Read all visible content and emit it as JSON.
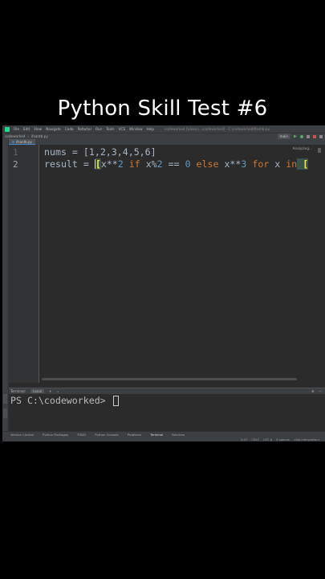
{
  "video_title": "Python Skill Test #6",
  "ide": {
    "menu": [
      "File",
      "Edit",
      "View",
      "Navigate",
      "Code",
      "Refactor",
      "Run",
      "Tools",
      "VCS",
      "Window",
      "Help"
    ],
    "project_path": "codeworked [\\Users\\...\\codeworked] - C:\\codeworked\\flashb.py",
    "breadcrumb_project": "codeworked",
    "breadcrumb_file": "ifsantb.py",
    "run_config": "main",
    "tab_label": "ifsantb.py",
    "analyzing": "Analyzing...",
    "line_numbers": [
      "1",
      "2"
    ],
    "code": {
      "line1": {
        "var": "nums",
        "eq": " = ",
        "list": "[1,2,3,4,5,6]"
      },
      "line2": {
        "var": "result",
        "eq": " = ",
        "open": "[",
        "x1": "x**",
        "n2": "2",
        "if": "if",
        "mod": " x%",
        "n2b": "2",
        "eqeq": " == ",
        "n0": "0",
        "else": "else",
        "x3": " x**",
        "n3": "3",
        "for": "for",
        "x_var": " x ",
        "in": "in",
        "tail": " ["
      }
    },
    "terminal": {
      "title": "Terminal:",
      "tab": "Local",
      "plus": "+",
      "dropdown": "⌄",
      "prompt": "PS C:\\codeworked>"
    },
    "bottom_tools": [
      "Version Control",
      "Python Packages",
      "TODO",
      "Python Console",
      "Problems",
      "Terminal",
      "Services"
    ],
    "status": [
      "2:47",
      "CRLF",
      "UTF-8",
      "4 spaces",
      "<No interpreter>"
    ]
  }
}
